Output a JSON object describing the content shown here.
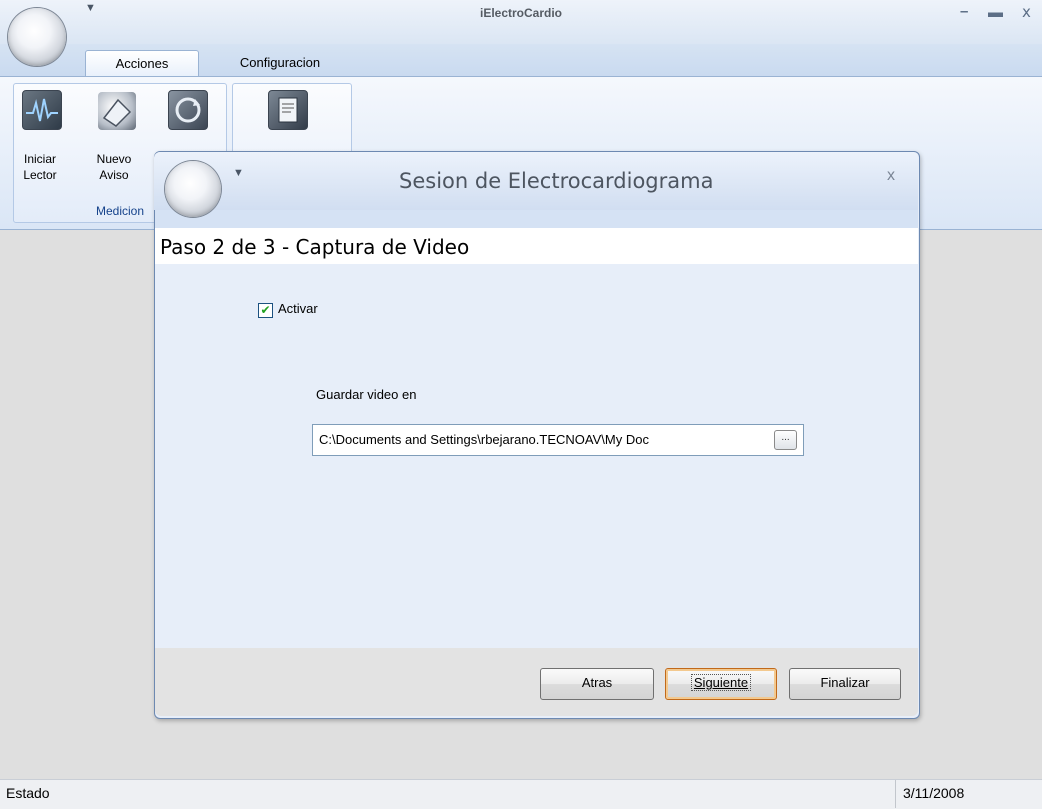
{
  "app": {
    "title": "iElectroCardio"
  },
  "ribbon": {
    "tabs": [
      {
        "label": "Acciones",
        "active": true
      },
      {
        "label": "Configuracion",
        "active": false
      }
    ],
    "groups": [
      {
        "label": "Medicion",
        "buttons": [
          {
            "label_line1": "Iniciar",
            "label_line2": "Lector",
            "icon": "ecg-reader-icon"
          },
          {
            "label_line1": "Nuevo",
            "label_line2": "Aviso",
            "icon": "new-notice-icon"
          },
          {
            "icon": "refresh-sync-icon"
          }
        ]
      },
      {
        "buttons": [
          {
            "icon": "document-report-icon"
          }
        ]
      }
    ]
  },
  "dialog": {
    "title": "Sesion de Electrocardiograma",
    "close_glyph": "x",
    "step_title": "Paso 2 de 3 - Captura de Video",
    "activate": {
      "label": "Activar",
      "checked": true
    },
    "save_label": "Guardar video en",
    "save_path": "C:\\Documents and Settings\\rbejarano.TECNOAV\\My Doc",
    "browse_label": "...",
    "buttons": {
      "back": "Atras",
      "next": "Siguiente",
      "finish": "Finalizar"
    }
  },
  "statusbar": {
    "left": "Estado",
    "right": "3/11/2008"
  }
}
